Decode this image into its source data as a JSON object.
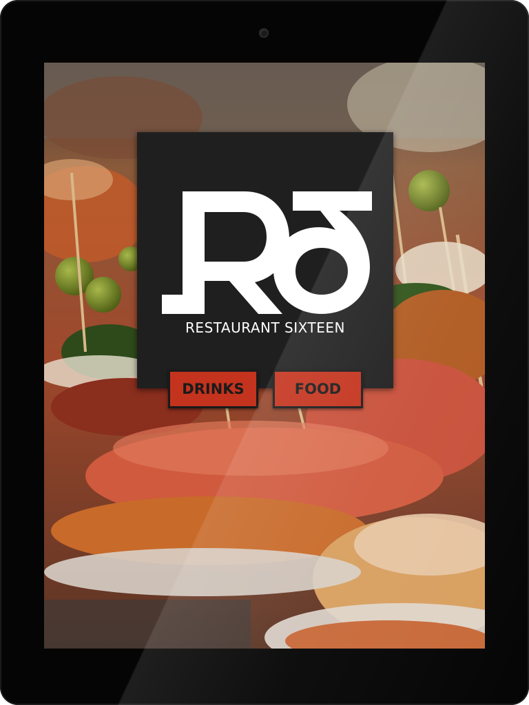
{
  "brand": {
    "monogram_alt": "RS",
    "name": "RESTAURANT SIXTEEN"
  },
  "nav": {
    "drinks_label": "DRINKS",
    "food_label": "FOOD"
  },
  "colors": {
    "device_bezel": "#050505",
    "logo_card": "#1f1f1f",
    "button_accent": "#c4331d",
    "button_text": "#1a1a1a",
    "logo_text": "#ffffff"
  },
  "background": {
    "image_subject": "tapas food photo"
  }
}
